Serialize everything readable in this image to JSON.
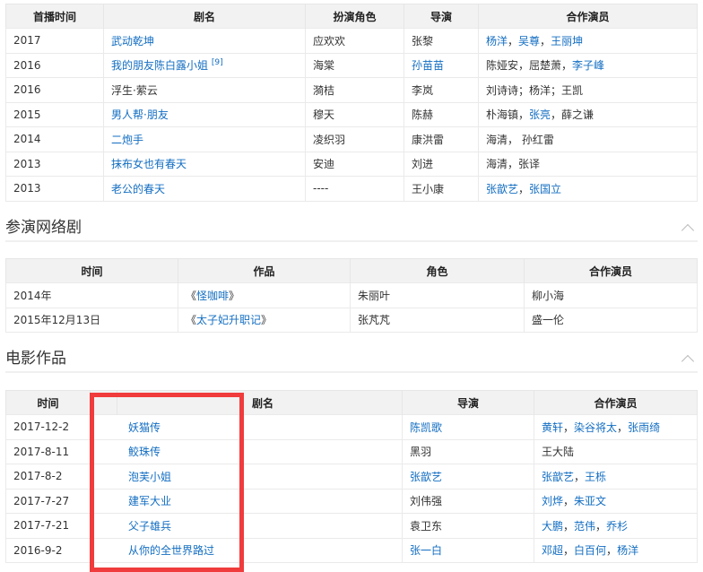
{
  "tv": {
    "headers": [
      "首播时间",
      "剧名",
      "扮演角色",
      "导演",
      "合作演员"
    ],
    "rows": [
      {
        "year": "2017",
        "title": "武动乾坤",
        "sup": "",
        "role": "应欢欢",
        "director": "张黎",
        "dlink": false,
        "costars": [
          {
            "t": "杨洋",
            "l": true
          },
          {
            "t": "，",
            "l": false
          },
          {
            "t": "吴尊",
            "l": true
          },
          {
            "t": "，",
            "l": false
          },
          {
            "t": "王丽坤",
            "l": true
          }
        ],
        "tlink": true
      },
      {
        "year": "2016",
        "title": "我的朋友陈白露小姐",
        "sup": "[9]",
        "role": "海棠",
        "director": "孙苗苗",
        "dlink": true,
        "costars": [
          {
            "t": "陈娅安，屈楚萧，",
            "l": false
          },
          {
            "t": "李子峰",
            "l": true
          }
        ],
        "tlink": true
      },
      {
        "year": "2016",
        "title": "浮生·萦云",
        "sup": "",
        "role": "漪桔",
        "director": "李岚",
        "dlink": false,
        "costars": [
          {
            "t": "刘诗诗；杨洋；王凯",
            "l": false
          }
        ],
        "tlink": false
      },
      {
        "year": "2015",
        "title": "男人帮·朋友",
        "sup": "",
        "role": "穆天",
        "director": "陈赫",
        "dlink": false,
        "costars": [
          {
            "t": "朴海镇，",
            "l": false
          },
          {
            "t": "张亮",
            "l": true
          },
          {
            "t": "，薛之谦",
            "l": false
          }
        ],
        "tlink": true
      },
      {
        "year": "2014",
        "title": "二炮手",
        "sup": "",
        "role": "凌织羽",
        "director": "康洪雷",
        "dlink": false,
        "costars": [
          {
            "t": "海清， 孙红雷",
            "l": false
          }
        ],
        "tlink": true
      },
      {
        "year": "2013",
        "title": "抹布女也有春天",
        "sup": "",
        "role": "安迪",
        "director": "刘进",
        "dlink": false,
        "costars": [
          {
            "t": "海清，张译",
            "l": false
          }
        ],
        "tlink": true
      },
      {
        "year": "2013",
        "title": "老公的春天",
        "sup": "",
        "role": "----",
        "director": "王小康",
        "dlink": false,
        "costars": [
          {
            "t": "张歆艺",
            "l": true
          },
          {
            "t": "，",
            "l": false
          },
          {
            "t": "张国立",
            "l": true
          }
        ],
        "tlink": true
      }
    ]
  },
  "web": {
    "heading": "参演网络剧",
    "headers": [
      "时间",
      "作品",
      "角色",
      "合作演员"
    ],
    "rows": [
      {
        "time": "2014年",
        "pre": "《",
        "title": "怪咖啡",
        "post": "》",
        "role": "朱丽叶",
        "costar": "柳小海"
      },
      {
        "time": "2015年12月13日",
        "pre": "《",
        "title": "太子妃升职记",
        "post": "》",
        "role": "张芃芃",
        "costar": "盛一伦"
      }
    ]
  },
  "film": {
    "heading": "电影作品",
    "headers": [
      "时间",
      "剧名",
      "导演",
      "合作演员"
    ],
    "rows": [
      {
        "time": "2017-12-2",
        "title": "妖猫传",
        "director": "陈凯歌",
        "dlink": true,
        "costars": [
          {
            "t": "黄轩",
            "l": true
          },
          {
            "t": "，",
            "l": false
          },
          {
            "t": "染谷将太",
            "l": true
          },
          {
            "t": "，",
            "l": false
          },
          {
            "t": "张雨绮",
            "l": true
          }
        ]
      },
      {
        "time": "2017-8-11",
        "title": "鲛珠传",
        "director": "黑羽",
        "dlink": false,
        "costars": [
          {
            "t": "王大陆",
            "l": false
          }
        ]
      },
      {
        "time": "2017-8-2",
        "title": "泡芙小姐",
        "director": "张歆艺",
        "dlink": true,
        "costars": [
          {
            "t": "张歆艺",
            "l": true
          },
          {
            "t": "，",
            "l": false
          },
          {
            "t": "王栎",
            "l": true
          }
        ]
      },
      {
        "time": "2017-7-27",
        "title": "建军大业",
        "director": "刘伟强",
        "dlink": false,
        "costars": [
          {
            "t": "刘烨",
            "l": true
          },
          {
            "t": "，",
            "l": false
          },
          {
            "t": "朱亚文",
            "l": true
          }
        ]
      },
      {
        "time": "2017-7-21",
        "title": "父子雄兵",
        "director": "袁卫东",
        "dlink": false,
        "costars": [
          {
            "t": "大鹏",
            "l": true
          },
          {
            "t": "，",
            "l": false
          },
          {
            "t": "范伟",
            "l": true
          },
          {
            "t": "，",
            "l": false
          },
          {
            "t": "乔杉",
            "l": true
          }
        ]
      },
      {
        "time": "2016-9-2",
        "title": "从你的全世界路过",
        "director": "张一白",
        "dlink": true,
        "costars": [
          {
            "t": "邓超",
            "l": true
          },
          {
            "t": "，",
            "l": false
          },
          {
            "t": "白百何",
            "l": true
          },
          {
            "t": "，",
            "l": false
          },
          {
            "t": "杨洋",
            "l": true
          }
        ]
      }
    ]
  },
  "colors": {
    "link": "#136ec2",
    "highlight": "#f03c3c"
  }
}
